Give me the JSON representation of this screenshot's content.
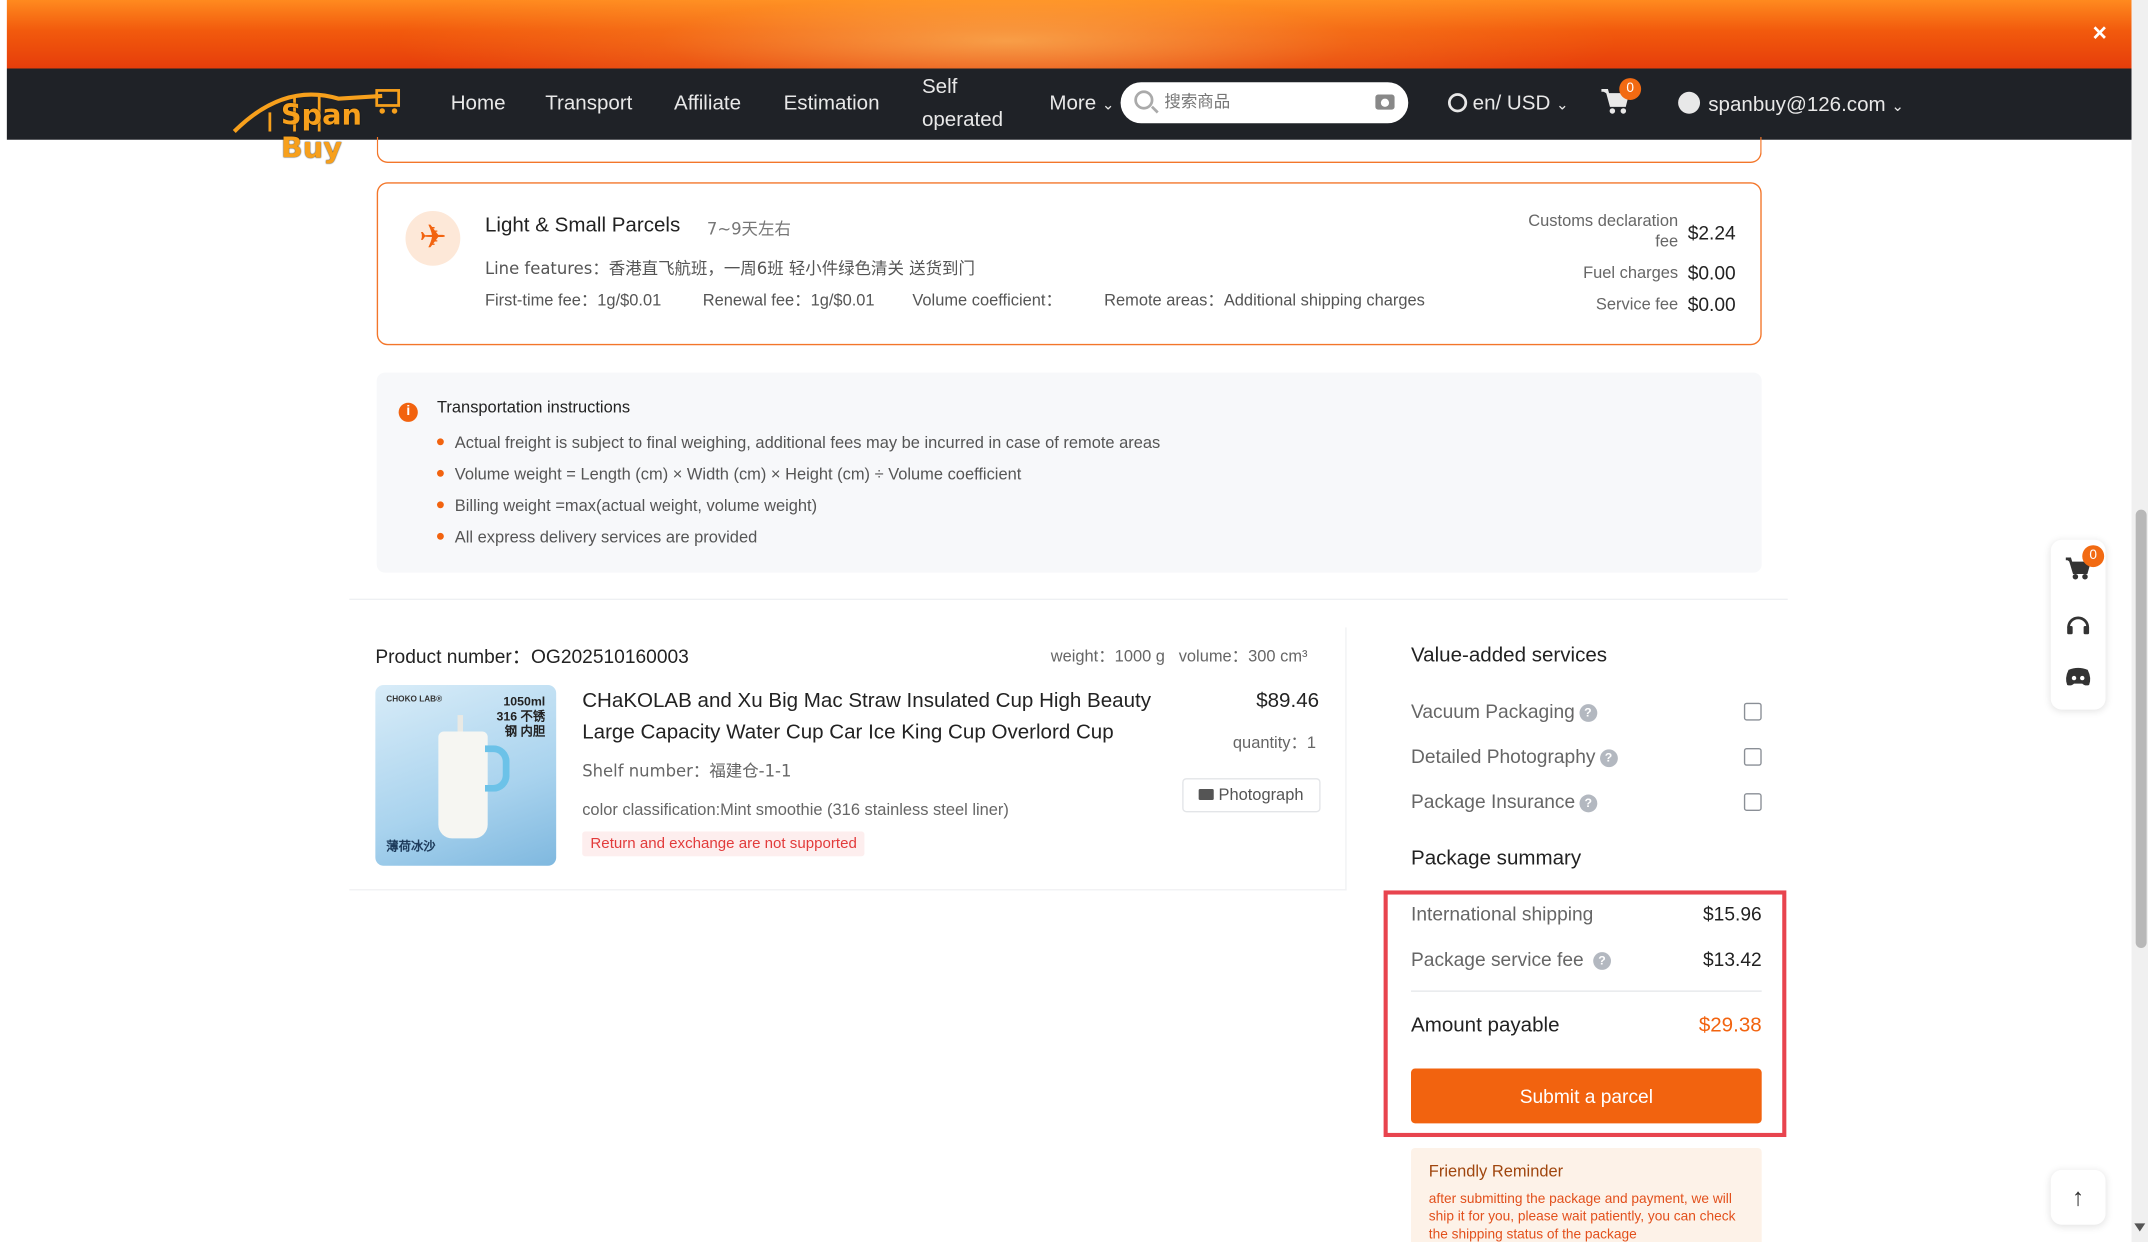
{
  "nav": {
    "logo": "Span Buy",
    "items": [
      "Home",
      "Transport",
      "Affiliate",
      "Estimation",
      "Self operated",
      "More"
    ],
    "search_placeholder": "搜索商品",
    "lang": "en/ USD",
    "cart_count": "0",
    "user": "spanbuy@126.com",
    "close": "×"
  },
  "shipping": {
    "title": "Light & Small Parcels",
    "days": "7~9天左右",
    "features": "Line features：香港直飞航班，一周6班 轻小件绿色清关 送货到门",
    "first_fee": "First-time fee：1g/$0.01",
    "renewal_fee": "Renewal fee：1g/$0.01",
    "volume_coef": "Volume coefficient：",
    "remote": "Remote areas：Additional shipping charges",
    "fees": [
      {
        "label": "Customs declaration fee",
        "value": "$2.24"
      },
      {
        "label": "Fuel charges",
        "value": "$0.00"
      },
      {
        "label": "Service fee",
        "value": "$0.00"
      }
    ]
  },
  "instructions": {
    "title": "Transportation instructions",
    "items": [
      "Actual freight is subject to final weighing, additional fees may be incurred in case of remote areas",
      "Volume weight = Length (cm) × Width (cm) × Height (cm) ÷ Volume coefficient",
      "Billing weight =max(actual weight, volume weight)",
      "All express delivery services are provided"
    ]
  },
  "product": {
    "number": "Product number：OG202510160003",
    "weight": "weight：1000 g",
    "volume": "volume：300 cm³",
    "title": "CHaKOLAB and Xu Big Mac Straw Insulated Cup High Beauty Large Capacity Water Cup Car Ice King Cup Overlord Cup",
    "price": "$89.46",
    "quantity": "quantity：1",
    "shelf": "Shelf number：福建仓-1-1",
    "color": "color classification:Mint smoothie (316 stainless steel liner)",
    "photo_btn": "Photograph",
    "no_return": "Return and exchange are not supported",
    "thumb": {
      "brand": "CHOKO LAB®",
      "capacity": "1050ml",
      "liner": "316 不锈钢 内胆",
      "name": "薄荷冰沙"
    }
  },
  "value_added": {
    "title": "Value-added services",
    "items": [
      {
        "label": "Vacuum Packaging",
        "checked": false
      },
      {
        "label": "Detailed Photography",
        "checked": false
      },
      {
        "label": "Package Insurance",
        "checked": false
      }
    ]
  },
  "summary": {
    "title": "Package summary",
    "intl_label": "International shipping",
    "intl_value": "$15.96",
    "service_label": "Package service fee",
    "service_value": "$13.42",
    "payable_label": "Amount payable",
    "payable_value": "$29.38",
    "submit": "Submit a parcel"
  },
  "reminder": {
    "title": "Friendly Reminder",
    "text": "after submitting the package and payment, we will ship it for you, please wait patiently, you can check the shipping status of the package"
  },
  "float": {
    "cart_count": "0"
  },
  "colors": {
    "accent": "#f2630f",
    "nav_bg": "#1f2227",
    "highlight": "#e8444e"
  }
}
